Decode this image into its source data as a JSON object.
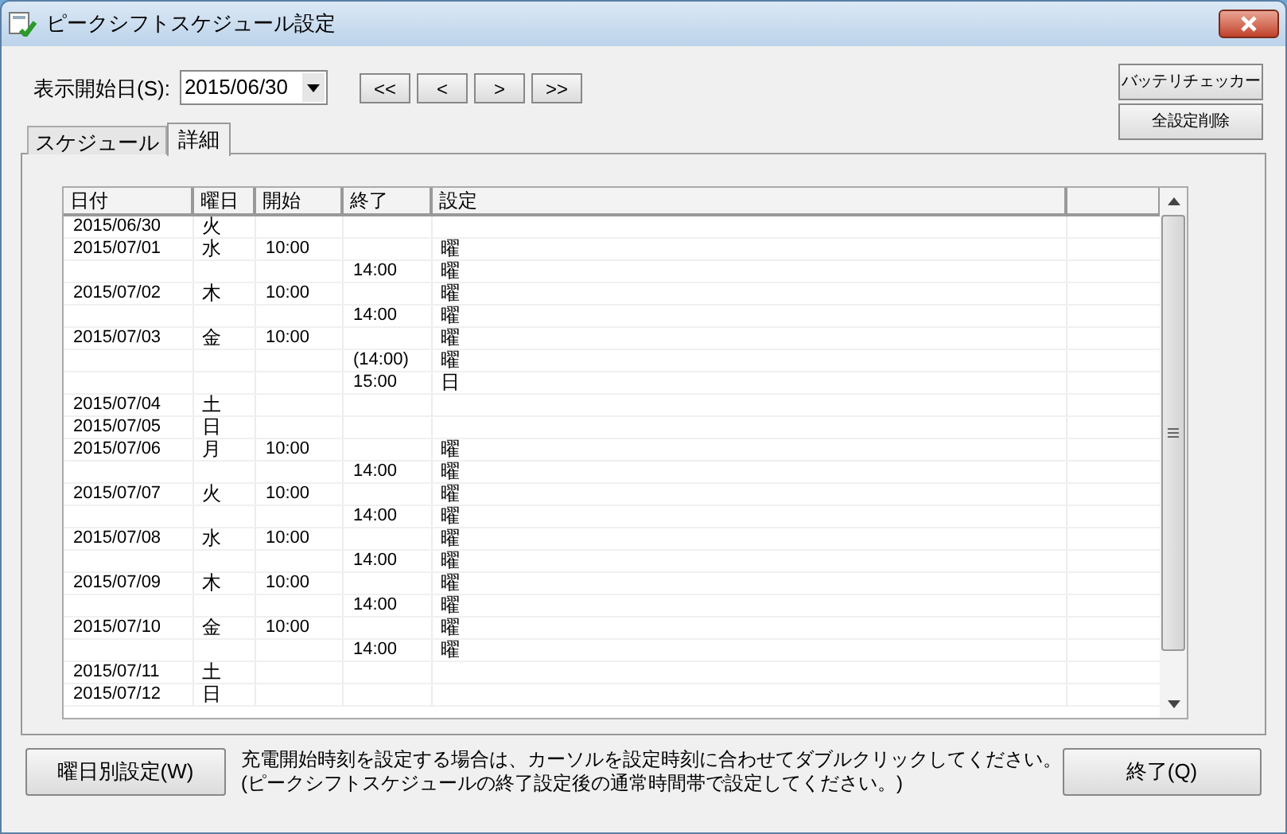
{
  "window": {
    "title": "ピークシフトスケジュール設定"
  },
  "toolbar": {
    "date_label": "表示開始日(S):",
    "date_value": "2015/06/30",
    "nav_buttons": [
      "<<",
      "<",
      ">",
      ">>"
    ],
    "right_buttons": [
      "バッテリチェッカー",
      "全設定削除"
    ]
  },
  "tabs": [
    {
      "label": "スケジュール",
      "selected": false
    },
    {
      "label": "詳細",
      "selected": true
    }
  ],
  "table": {
    "columns": [
      "日付",
      "曜日",
      "開始",
      "終了",
      "設定"
    ],
    "rows": [
      {
        "date": "2015/06/30",
        "weekday": "火"
      },
      {
        "date": "2015/07/01",
        "weekday": "水",
        "start": "10:00",
        "setting": "曜"
      },
      {
        "end": "14:00",
        "setting": "曜"
      },
      {
        "date": "2015/07/02",
        "weekday": "木",
        "start": "10:00",
        "setting": "曜"
      },
      {
        "end": "14:00",
        "setting": "曜"
      },
      {
        "date": "2015/07/03",
        "weekday": "金",
        "start": "10:00",
        "setting": "曜"
      },
      {
        "end": "(14:00)",
        "setting": "曜"
      },
      {
        "end": "15:00",
        "setting": "日"
      },
      {
        "date": "2015/07/04",
        "weekday": "土"
      },
      {
        "date": "2015/07/05",
        "weekday": "日"
      },
      {
        "date": "2015/07/06",
        "weekday": "月",
        "start": "10:00",
        "setting": "曜"
      },
      {
        "end": "14:00",
        "setting": "曜"
      },
      {
        "date": "2015/07/07",
        "weekday": "火",
        "start": "10:00",
        "setting": "曜"
      },
      {
        "end": "14:00",
        "setting": "曜"
      },
      {
        "date": "2015/07/08",
        "weekday": "水",
        "start": "10:00",
        "setting": "曜"
      },
      {
        "end": "14:00",
        "setting": "曜"
      },
      {
        "date": "2015/07/09",
        "weekday": "木",
        "start": "10:00",
        "setting": "曜"
      },
      {
        "end": "14:00",
        "setting": "曜"
      },
      {
        "date": "2015/07/10",
        "weekday": "金",
        "start": "10:00",
        "setting": "曜"
      },
      {
        "end": "14:00",
        "setting": "曜"
      },
      {
        "date": "2015/07/11",
        "weekday": "土"
      },
      {
        "date": "2015/07/12",
        "weekday": "日"
      }
    ]
  },
  "footer": {
    "weekday_button": "曜日別設定(W)",
    "message": [
      "充電開始時刻を設定する場合は、カーソルを設定時刻に合わせてダブルクリックしてください。",
      "(ピークシフトスケジュールの終了設定後の通常時間帯で設定してください。)"
    ],
    "close_button": "終了(Q)"
  }
}
